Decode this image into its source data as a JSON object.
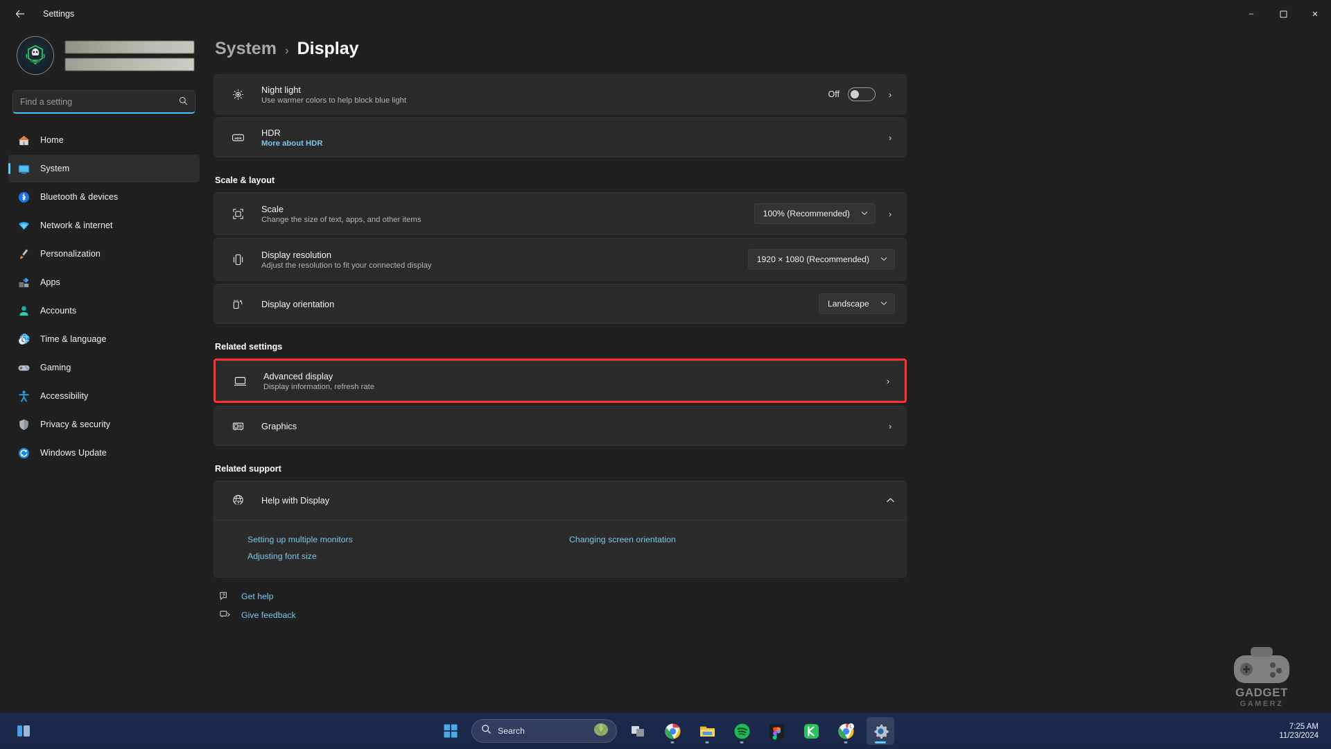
{
  "window": {
    "title": "Settings",
    "back_icon": "back-arrow-icon",
    "minimize": "–",
    "maximize": "❐",
    "close": "✕"
  },
  "sidebar": {
    "account": {
      "avatar_icon": "user-avatar-icon",
      "name_redacted": "",
      "email_redacted": ""
    },
    "search": {
      "placeholder": "Find a setting",
      "value": "",
      "icon": "search-icon"
    },
    "items": [
      {
        "label": "Home",
        "icon": "home-icon",
        "active": false
      },
      {
        "label": "System",
        "icon": "system-icon",
        "active": true
      },
      {
        "label": "Bluetooth & devices",
        "icon": "bluetooth-icon",
        "active": false
      },
      {
        "label": "Network & internet",
        "icon": "network-icon",
        "active": false
      },
      {
        "label": "Personalization",
        "icon": "personalization-icon",
        "active": false
      },
      {
        "label": "Apps",
        "icon": "apps-icon",
        "active": false
      },
      {
        "label": "Accounts",
        "icon": "accounts-icon",
        "active": false
      },
      {
        "label": "Time & language",
        "icon": "time-language-icon",
        "active": false
      },
      {
        "label": "Gaming",
        "icon": "gaming-icon",
        "active": false
      },
      {
        "label": "Accessibility",
        "icon": "accessibility-icon",
        "active": false
      },
      {
        "label": "Privacy & security",
        "icon": "privacy-security-icon",
        "active": false
      },
      {
        "label": "Windows Update",
        "icon": "windows-update-icon",
        "active": false
      }
    ]
  },
  "breadcrumb": {
    "parent": "System",
    "separator": "›",
    "current": "Display"
  },
  "settings": {
    "night_light": {
      "title": "Night light",
      "subtitle": "Use warmer colors to help block blue light",
      "toggle_state": "Off",
      "icon": "night-light-icon",
      "chevron": "›"
    },
    "hdr": {
      "title": "HDR",
      "link": "More about HDR",
      "icon": "hdr-icon",
      "chevron": "›"
    },
    "scale_layout_header": "Scale & layout",
    "scale": {
      "title": "Scale",
      "subtitle": "Change the size of text, apps, and other items",
      "value": "100% (Recommended)",
      "icon": "scale-icon",
      "chevron": "›",
      "dd_chevron": "⌄"
    },
    "resolution": {
      "title": "Display resolution",
      "subtitle": "Adjust the resolution to fit your connected display",
      "value": "1920 × 1080 (Recommended)",
      "icon": "resolution-icon",
      "dd_chevron": "⌄"
    },
    "orientation": {
      "title": "Display orientation",
      "value": "Landscape",
      "icon": "orientation-icon",
      "dd_chevron": "⌄"
    },
    "related_settings_header": "Related settings",
    "advanced_display": {
      "title": "Advanced display",
      "subtitle": "Display information, refresh rate",
      "icon": "monitor-icon",
      "chevron": "›",
      "highlight_color": "#ff3131"
    },
    "graphics": {
      "title": "Graphics",
      "icon": "graphics-icon",
      "chevron": "›"
    },
    "related_support_header": "Related support",
    "help": {
      "title": "Help with Display",
      "icon": "globe-help-icon",
      "expand_chevron": "⌃",
      "links": [
        "Setting up multiple monitors",
        "Changing screen orientation",
        "Adjusting font size"
      ]
    },
    "footer": [
      {
        "label": "Get help",
        "icon": "get-help-icon"
      },
      {
        "label": "Give feedback",
        "icon": "give-feedback-icon"
      }
    ]
  },
  "watermark": {
    "line1": "GADGET",
    "line2": "GAMERZ",
    "icon": "gamepad-icon"
  },
  "taskbar": {
    "widgets_icon": "widgets-icon",
    "start_icon": "windows-start-icon",
    "search": {
      "text": "Search",
      "icon": "search-icon",
      "decor_icon": "lettuce-icon"
    },
    "apps": [
      {
        "name": "task-view-icon",
        "running": false
      },
      {
        "name": "chrome-icon",
        "running": true
      },
      {
        "name": "file-explorer-icon",
        "running": true
      },
      {
        "name": "spotify-icon",
        "running": true
      },
      {
        "name": "figma-icon",
        "running": false
      },
      {
        "name": "kakaotalk-icon",
        "running": false
      },
      {
        "name": "chrome-secondary-icon",
        "running": true
      },
      {
        "name": "settings-icon",
        "running": true,
        "active": true
      }
    ],
    "clock": {
      "time": "7:25 AM",
      "date": "11/23/2024"
    }
  },
  "colors": {
    "accent": "#60cdff",
    "link": "#7cc6e8",
    "highlight": "#ff3131",
    "card_bg": "#2b2b2b"
  }
}
